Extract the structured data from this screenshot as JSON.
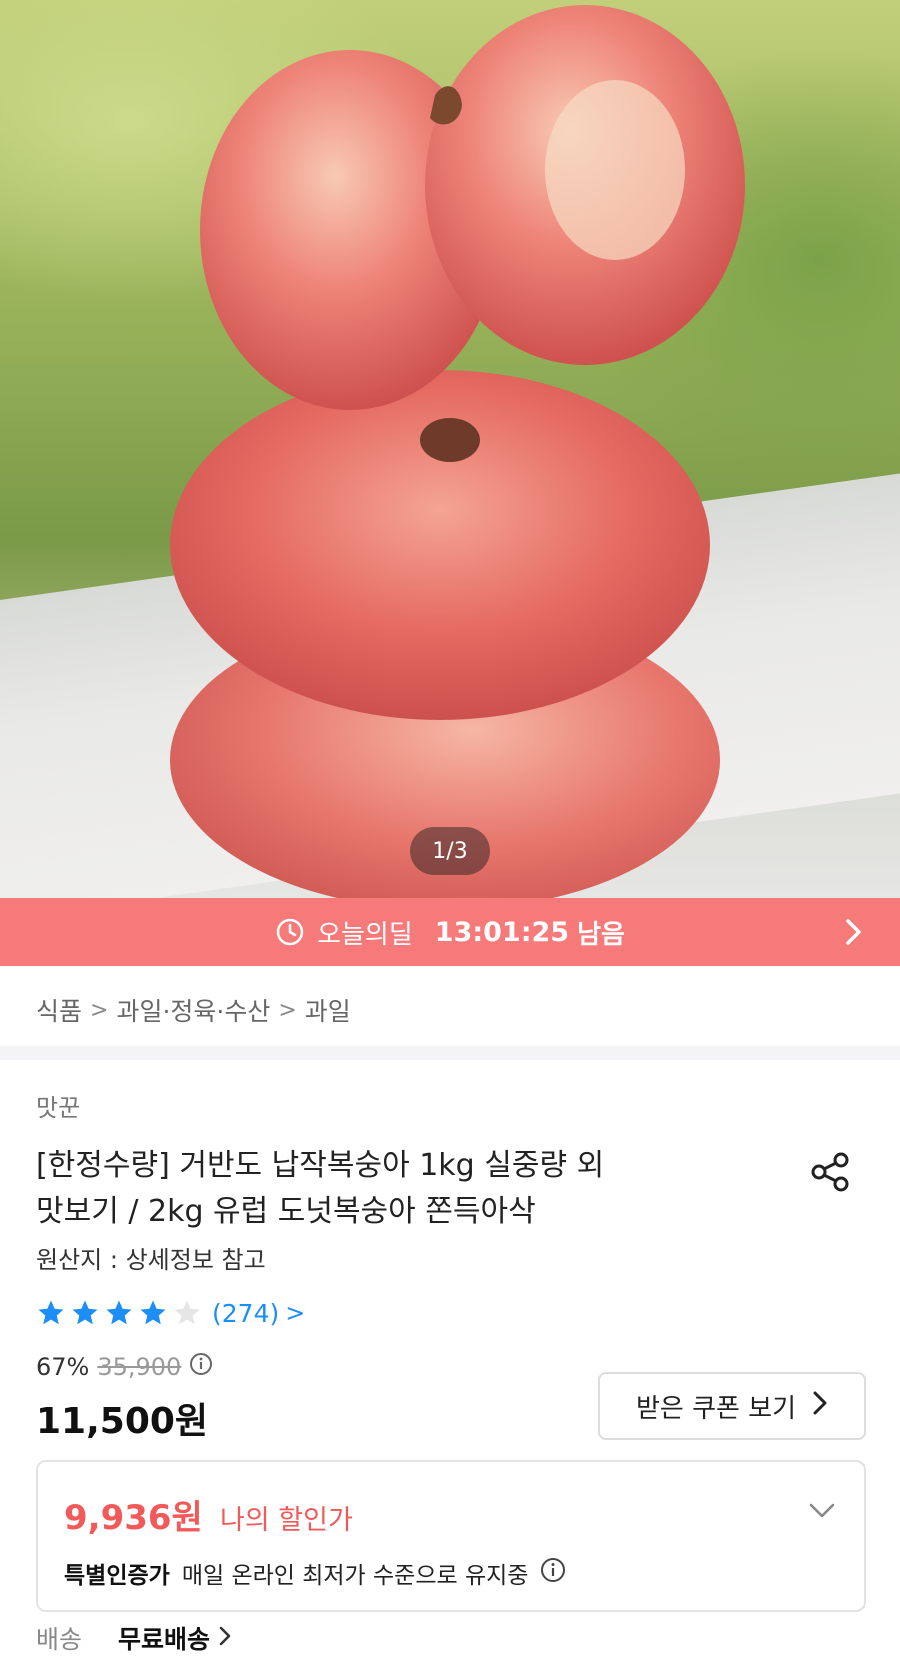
{
  "hero": {
    "image_label": "donut peaches stacked",
    "page_indicator": "1/3"
  },
  "deal": {
    "icon": "clock-icon",
    "label": "오늘의딜",
    "time_left": "13:01:25",
    "suffix": "남음",
    "banner_color": "#f77a7a"
  },
  "breadcrumb": {
    "items": [
      "식품",
      "과일·정육·수산",
      "과일"
    ]
  },
  "product": {
    "seller": "맛꾼",
    "title_line1": "[한정수량] 거반도 납작복숭아 1kg 실중량 외",
    "title_line2": "맛보기 / 2kg 유럽 도넛복숭아 쫀득아삭",
    "origin": "원산지 : 상세정보 참고",
    "rating": 4,
    "rating_max": 5,
    "review_count": "(274)",
    "discount_rate": "67%",
    "original_price": "35,900",
    "price": "11,500원",
    "coupon_button": "받은 쿠폰 보기"
  },
  "my_discount": {
    "amount": "9,936원",
    "label": "나의 할인가",
    "cert_label": "특별인증가",
    "cert_text": "매일 온라인 최저가 수준으로 유지중"
  },
  "shipping": {
    "label": "배송",
    "value": "무료배송"
  },
  "colors": {
    "accent_red": "#f25a5a",
    "star_blue": "#1c8ef5",
    "star_empty": "#e6e6e6"
  }
}
